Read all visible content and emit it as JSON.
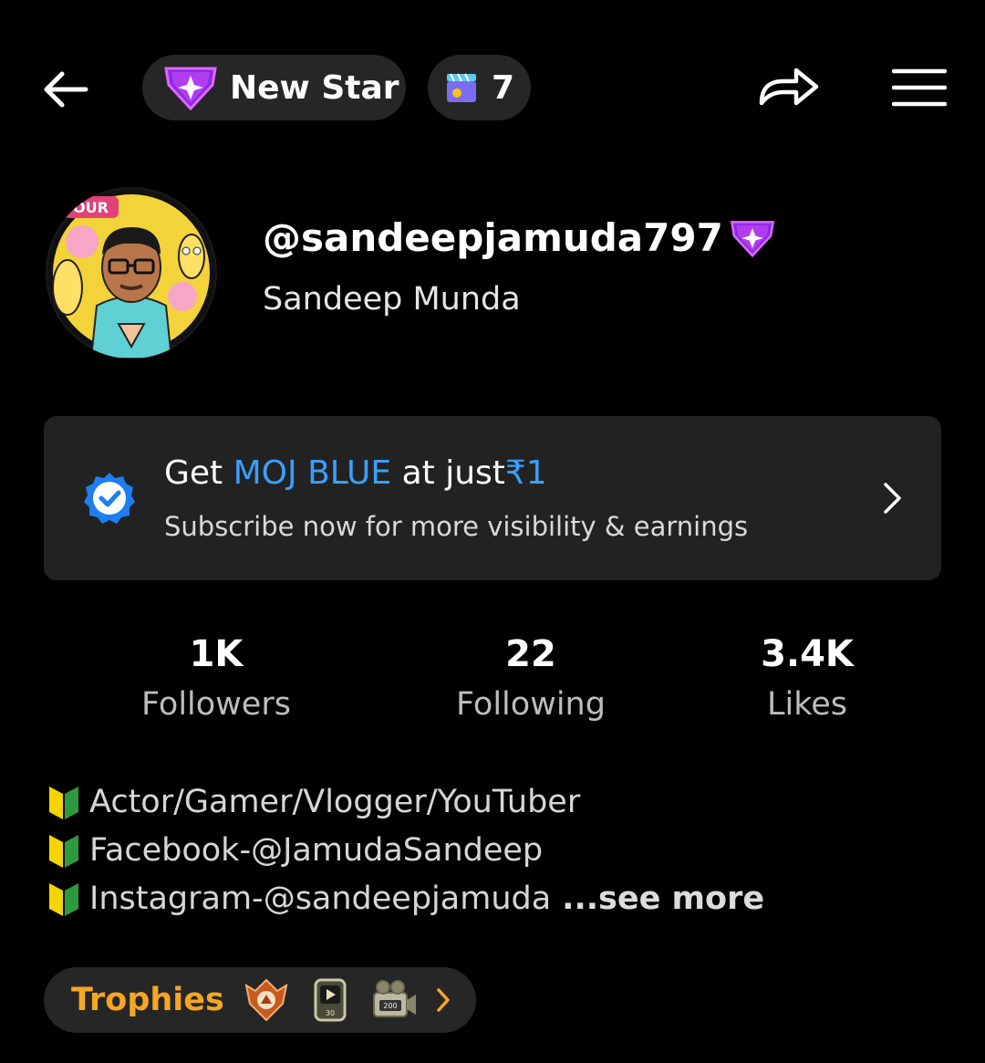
{
  "header": {
    "back_icon": "back-arrow-icon",
    "badge_label": "New Star",
    "badge_icon": "purple-star-gem-icon",
    "clap_count": "7",
    "clap_icon": "clapperboard-icon",
    "share_icon": "share-arrow-icon",
    "menu_icon": "hamburger-menu-icon"
  },
  "profile": {
    "handle": "@sandeepjamuda797",
    "display_name": "Sandeep Munda",
    "avatar_icon": "avatar-image"
  },
  "banner": {
    "get": "Get",
    "brand": "MOJ BLUE",
    "at_just": "at just",
    "price": "₹1",
    "subtitle": "Subscribe now for more visibility & earnings",
    "brand_color": "#3aa0ff"
  },
  "stats": [
    {
      "value": "1K",
      "label": "Followers"
    },
    {
      "value": "22",
      "label": "Following"
    },
    {
      "value": "3.4K",
      "label": "Likes"
    }
  ],
  "bio": {
    "lines": [
      "Actor/Gamer/Vlogger/YouTuber",
      "Facebook-@JamudaSandeep",
      "Instagram-@sandeepjamuda"
    ],
    "see_more": "...see more"
  },
  "trophies": {
    "label": "Trophies",
    "label_color": "#f5a623",
    "badge_text": [
      "",
      "30",
      "200"
    ]
  }
}
